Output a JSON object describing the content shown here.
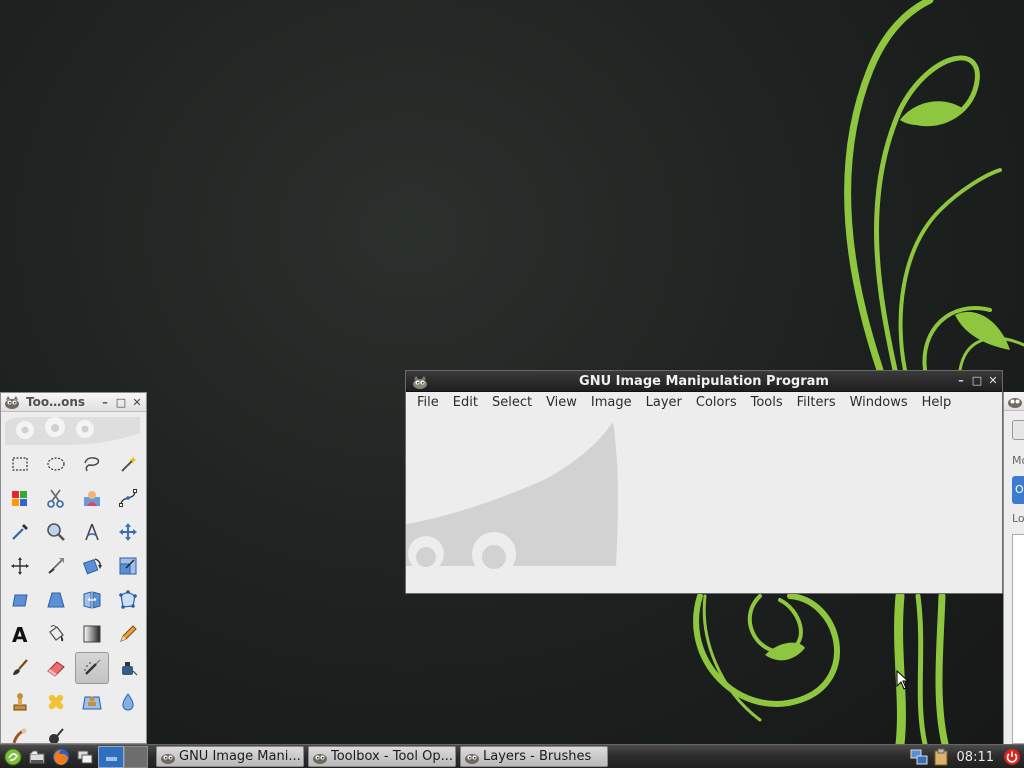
{
  "toolbox": {
    "title": "Too…ons",
    "tools": [
      "rect-select-icon",
      "ellipse-select-icon",
      "free-select-icon",
      "fuzzy-select-icon",
      "select-by-color-icon",
      "scissors-select-icon",
      "foreground-select-icon",
      "paths-icon",
      "color-picker-icon",
      "zoom-icon",
      "measure-icon",
      "move-icon",
      "align-icon",
      "crop-icon",
      "rotate-icon",
      "scale-icon",
      "shear-icon",
      "perspective-icon",
      "flip-icon",
      "cage-transform-icon",
      "text-icon",
      "bucket-fill-icon",
      "gradient-icon",
      "pencil-icon",
      "paintbrush-icon",
      "eraser-icon",
      "airbrush-icon",
      "ink-icon",
      "clone-icon",
      "heal-icon",
      "perspective-clone-icon",
      "blur-icon",
      "smudge-icon",
      "dodge-burn-icon"
    ],
    "active_tool_index": 26
  },
  "main_window": {
    "title": "GNU Image Manipulation Program",
    "menu": [
      "File",
      "Edit",
      "Select",
      "View",
      "Image",
      "Layer",
      "Colors",
      "Tools",
      "Filters",
      "Windows",
      "Help"
    ]
  },
  "partial_window": {
    "labels": [
      "Mo",
      "O",
      "Lo"
    ]
  },
  "taskbar": {
    "tasks": [
      "GNU Image Mani...",
      "Toolbox - Tool Op...",
      "Layers - Brushes"
    ],
    "clock": "08:11"
  },
  "colors": {
    "vine": "#8ec63f",
    "titlebar_dark": "#2a2a2a",
    "window_bg": "#ededed",
    "power_red": "#d9261c"
  }
}
